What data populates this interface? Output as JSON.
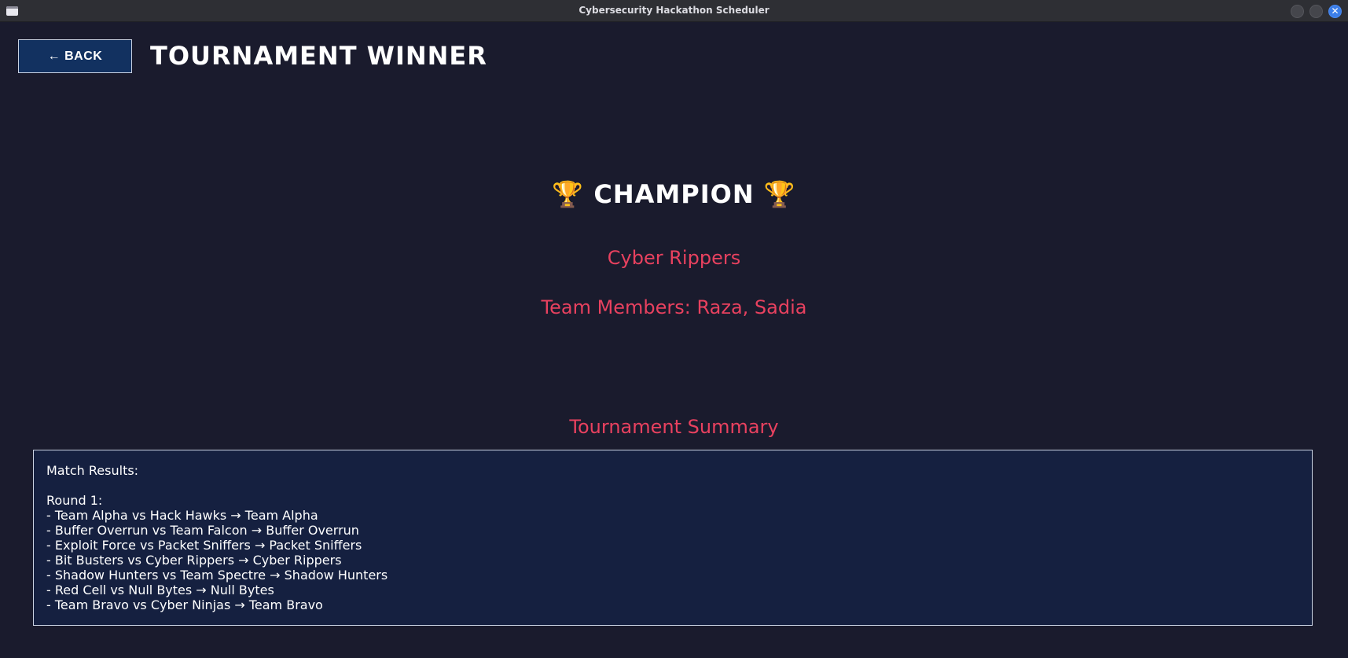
{
  "window": {
    "title": "Cybersecurity Hackathon Scheduler"
  },
  "header": {
    "back_label": "← BACK",
    "page_title": "TOURNAMENT WINNER"
  },
  "champion": {
    "heading": "CHAMPION",
    "trophy_glyph": "🏆",
    "team_name": "Cyber Rippers",
    "members_text": "Team Members: Raza, Sadia"
  },
  "summary": {
    "heading": "Tournament Summary",
    "match_results_label": "Match Results:",
    "round_label": "Round 1:",
    "matches": [
      "- Team Alpha vs Hack Hawks → Team Alpha",
      "- Buffer Overrun vs Team Falcon → Buffer Overrun",
      "- Exploit Force vs Packet Sniffers → Packet Sniffers",
      "- Bit Busters vs Cyber Rippers → Cyber Rippers",
      "- Shadow Hunters vs Team Spectre → Shadow Hunters",
      "- Red Cell vs Null Bytes → Null Bytes",
      "- Team Bravo vs Cyber Ninjas → Team Bravo"
    ]
  },
  "colors": {
    "background": "#1a1b2d",
    "accent": "#e8415f",
    "button_bg": "#123160",
    "summary_bg": "#152040"
  }
}
